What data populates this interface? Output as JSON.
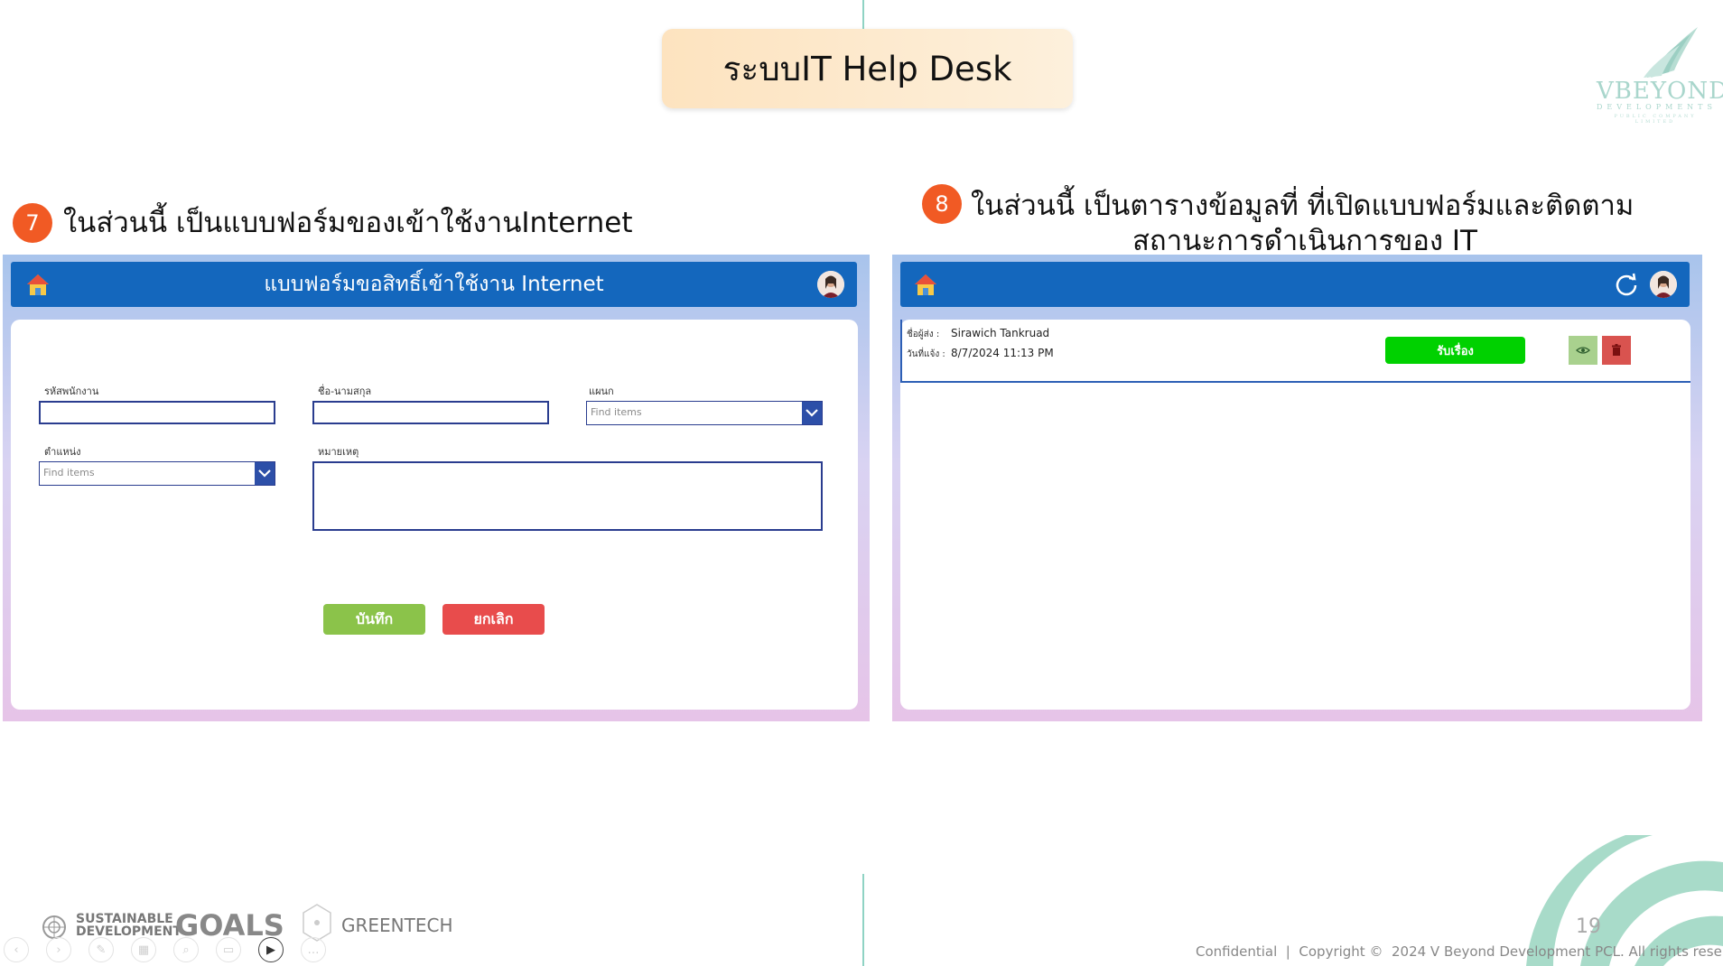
{
  "slide": {
    "title": "ระบบIT Help Desk",
    "page_number": "19",
    "copyright": "Confidential  |  Copyright ©  2024 V Beyond Development PCL. All rights reserved"
  },
  "logo": {
    "name": "VBEYOND",
    "sub": "DEVELOPMENTS",
    "tiny": "PUBLIC COMPANY LIMITED"
  },
  "left": {
    "step_number": "7",
    "caption": "ในส่วนนี้ เป็นแบบฟอร์มของเข้าใช้งานInternet",
    "app": {
      "header_title": "แบบฟอร์มขอสิทธิ์เข้าใช้งาน Internet",
      "fields": {
        "employee_id_label": "รหัสพนักงาน",
        "name_label": "ชื่อ-นามสกุล",
        "department_label": "แผนก",
        "department_placeholder": "Find items",
        "position_label": "ตำแหน่ง",
        "position_placeholder": "Find items",
        "remark_label": "หมายเหตุ"
      },
      "save_label": "บันทึก",
      "cancel_label": "ยกเลิก"
    }
  },
  "right": {
    "step_number": "8",
    "caption_line1": "ในส่วนนี้ เป็นตารางข้อมูลที่ ที่เปิดแบบฟอร์มและติดตาม",
    "caption_line2": "สถานะการดำเนินการของ IT",
    "app": {
      "rows": [
        {
          "sender_label": "ชื่อผู้ส่ง :",
          "sender": "Sirawich Tankruad",
          "date_label": "วันที่แจ้ง :",
          "date": "8/7/2024 11:13 PM",
          "accept_label": "รับเรื่อง"
        }
      ]
    }
  },
  "footer": {
    "sdg_line1": "SUSTAINABLE",
    "sdg_line2": "DEVELOPMENT",
    "sdg_goals": "GOALS",
    "greentech": "GREENTECH"
  },
  "colors": {
    "header_blue": "#1467bd",
    "save_green": "#8bc34a",
    "cancel_red": "#e84c4c",
    "accept_green": "#00d100",
    "step_orange": "#f15a24"
  }
}
